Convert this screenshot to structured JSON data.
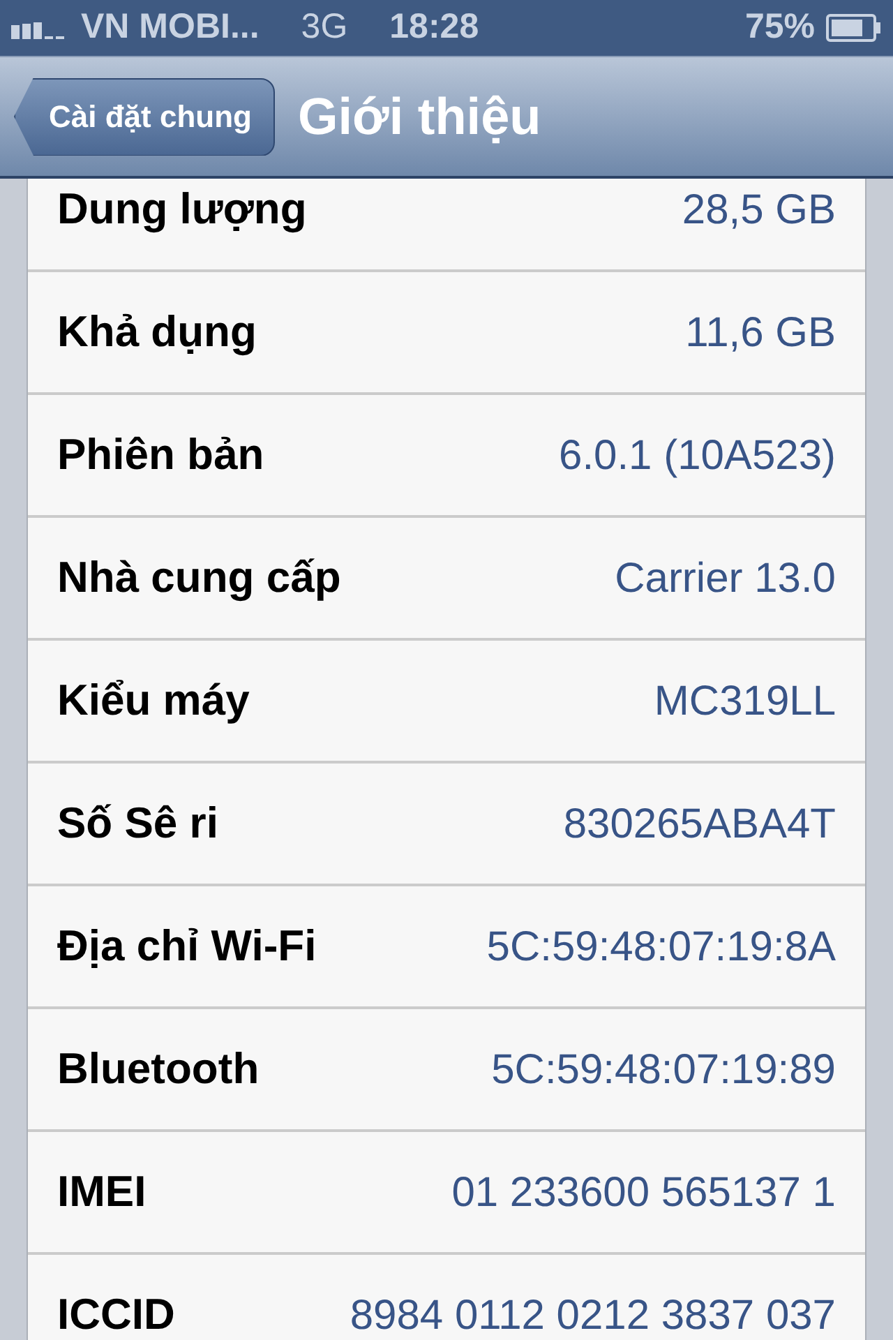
{
  "status_bar": {
    "carrier": "VN MOBI...",
    "network": "3G",
    "time": "18:28",
    "battery": "75%"
  },
  "nav_bar": {
    "back_button": "Cài đặt chung",
    "title": "Giới thiệu"
  },
  "rows": [
    {
      "label": "Dung lượng",
      "value": "28,5 GB"
    },
    {
      "label": "Khả dụng",
      "value": "11,6 GB"
    },
    {
      "label": "Phiên bản",
      "value": "6.0.1 (10A523)"
    },
    {
      "label": "Nhà cung cấp",
      "value": "Carrier 13.0"
    },
    {
      "label": "Kiểu máy",
      "value": "MC319LL"
    },
    {
      "label": "Số Sê ri",
      "value": "830265ABA4T"
    },
    {
      "label": "Địa chỉ Wi-Fi",
      "value": "5C:59:48:07:19:8A"
    },
    {
      "label": "Bluetooth",
      "value": "5C:59:48:07:19:89"
    },
    {
      "label": "IMEI",
      "value": "01 233600 565137 1"
    },
    {
      "label": "ICCID",
      "value": "8984 0112 0212 3837 037"
    }
  ]
}
